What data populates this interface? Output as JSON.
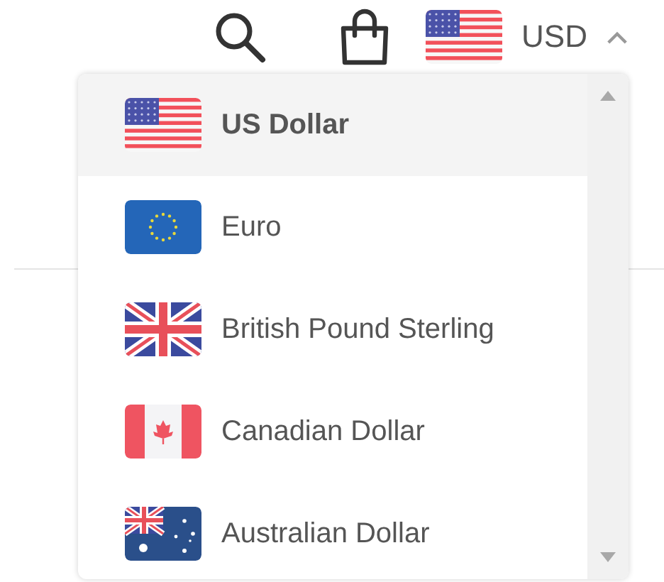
{
  "header": {
    "currency": {
      "code": "USD",
      "kind": "us",
      "expanded": true
    }
  },
  "currency_menu": {
    "options": [
      {
        "label": "US Dollar",
        "kind": "us",
        "selected": true
      },
      {
        "label": "Euro",
        "kind": "eu",
        "selected": false
      },
      {
        "label": "British Pound Sterling",
        "kind": "gb",
        "selected": false
      },
      {
        "label": "Canadian Dollar",
        "kind": "ca",
        "selected": false
      },
      {
        "label": "Australian Dollar",
        "kind": "au",
        "selected": false
      }
    ]
  }
}
